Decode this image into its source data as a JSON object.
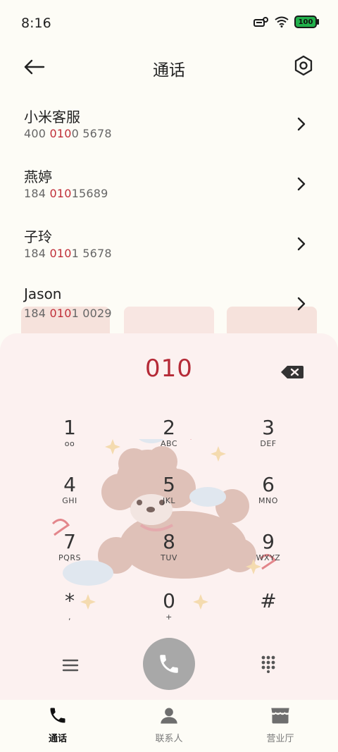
{
  "status": {
    "time": "8:16",
    "battery": "100"
  },
  "header": {
    "title": "通话"
  },
  "results": [
    {
      "name": "小米客服",
      "num_parts": [
        {
          "t": "400 ",
          "h": false
        },
        {
          "t": "010",
          "h": true
        },
        {
          "t": "0 5678",
          "h": false
        }
      ]
    },
    {
      "name": "燕婷",
      "num_parts": [
        {
          "t": "184 ",
          "h": false
        },
        {
          "t": "010",
          "h": true
        },
        {
          "t": "15689",
          "h": false
        }
      ]
    },
    {
      "name": "子玲",
      "num_parts": [
        {
          "t": "184 ",
          "h": false
        },
        {
          "t": "010",
          "h": true
        },
        {
          "t": "1 5678",
          "h": false
        }
      ]
    },
    {
      "name": "Jason",
      "num_parts": [
        {
          "t": "184 ",
          "h": false
        },
        {
          "t": "010",
          "h": true
        },
        {
          "t": "1 0029",
          "h": false
        }
      ]
    }
  ],
  "dialer": {
    "display": "010",
    "keys": [
      {
        "d": "1",
        "l": "ᴏᴏ"
      },
      {
        "d": "2",
        "l": "ABC"
      },
      {
        "d": "3",
        "l": "DEF"
      },
      {
        "d": "4",
        "l": "GHI"
      },
      {
        "d": "5",
        "l": "JKL"
      },
      {
        "d": "6",
        "l": "MNO"
      },
      {
        "d": "7",
        "l": "PQRS"
      },
      {
        "d": "8",
        "l": "TUV"
      },
      {
        "d": "9",
        "l": "WXYZ"
      },
      {
        "d": "*",
        "l": ","
      },
      {
        "d": "0",
        "l": "+"
      },
      {
        "d": "#",
        "l": ""
      }
    ]
  },
  "nav": {
    "calls": "通话",
    "contacts": "联系人",
    "store": "营业厅"
  },
  "colors": {
    "accent": "#b52a37",
    "highlight": "#c0303a",
    "sheet": "#fcf1f0"
  }
}
